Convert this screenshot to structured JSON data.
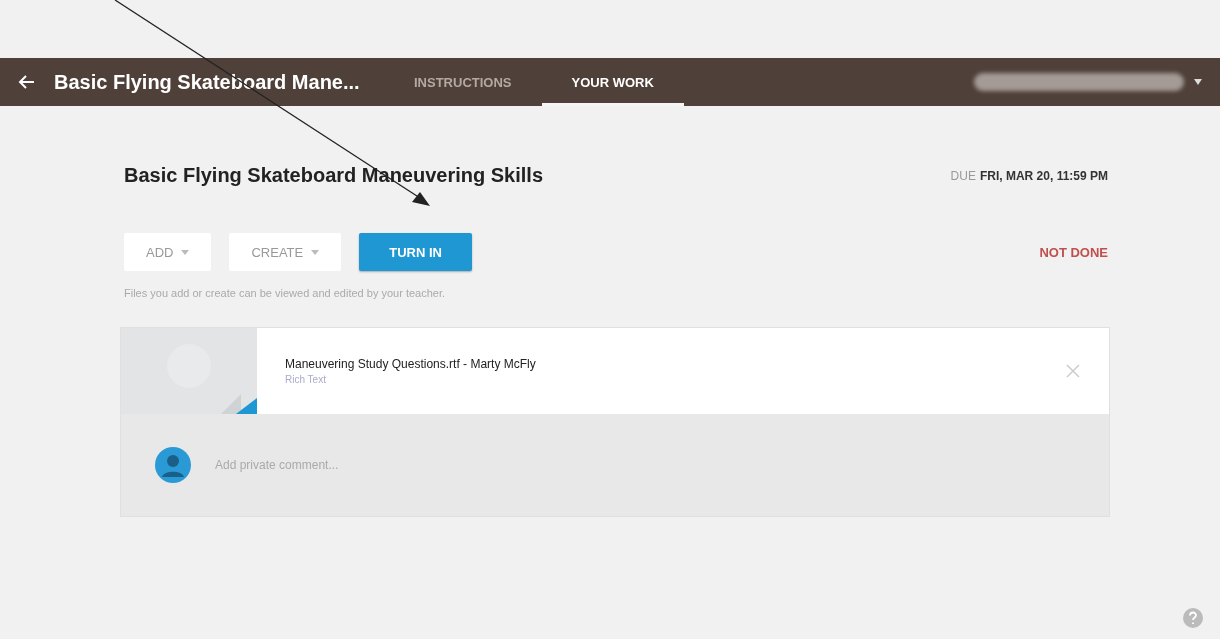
{
  "header": {
    "title": "Basic Flying Skateboard Mane...",
    "tabs": [
      {
        "label": "INSTRUCTIONS",
        "selected": false
      },
      {
        "label": "YOUR WORK",
        "selected": true
      }
    ]
  },
  "assignment": {
    "title": "Basic Flying Skateboard Maneuvering Skills",
    "due_label": "DUE",
    "due": "FRI, MAR 20, 11:59 PM",
    "status": "NOT DONE"
  },
  "actions": [
    {
      "label": "ADD",
      "kind": "menu"
    },
    {
      "label": "CREATE",
      "kind": "menu"
    },
    {
      "label": "TURN IN",
      "kind": "primary"
    }
  ],
  "note": "Files you add or create can be viewed and edited by your teacher.",
  "attachment": {
    "name": "Maneuvering Study Questions.rtf - Marty McFly",
    "type": "Rich Text"
  },
  "comment": {
    "placeholder": "Add private comment..."
  }
}
